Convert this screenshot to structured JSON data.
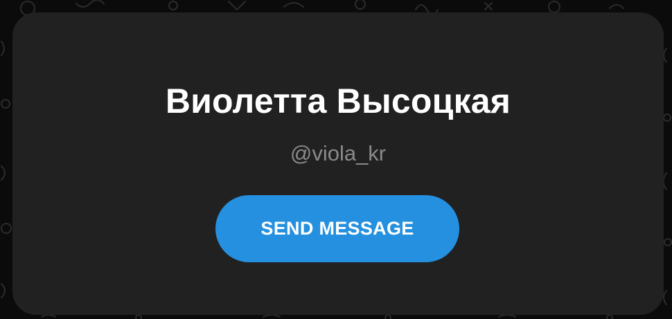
{
  "profile": {
    "name": "Виолетта Высоцкая",
    "username": "@viola_kr",
    "send_label": "SEND MESSAGE"
  },
  "colors": {
    "background": "#0b0b0b",
    "card": "#212121",
    "name_text": "#ffffff",
    "username_text": "#8a8a8a",
    "button": "#2490df",
    "button_text": "#ffffff"
  }
}
